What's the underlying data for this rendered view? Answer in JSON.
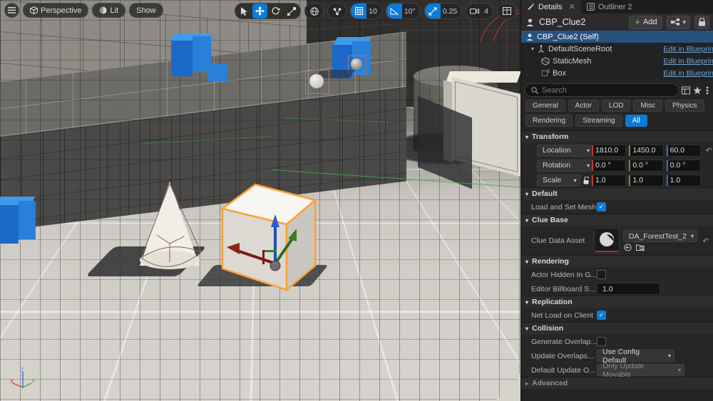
{
  "viewport": {
    "left_toolbar": [
      {
        "name": "viewport-menu",
        "icon": "hamburger-icon",
        "label": ""
      },
      {
        "name": "camera-mode",
        "icon": "cube-icon",
        "label": "Perspective"
      },
      {
        "name": "view-mode",
        "icon": "lit-sphere-icon",
        "label": "Lit"
      },
      {
        "name": "show-flags",
        "icon": "",
        "label": "Show"
      }
    ],
    "right_toolbar": {
      "tools": [
        {
          "name": "select-tool",
          "icon": "cursor-arrow-icon",
          "active": false
        },
        {
          "name": "move-tool",
          "icon": "move-arrows-icon",
          "active": true
        },
        {
          "name": "rotate-tool",
          "icon": "rotate-icon",
          "active": false
        },
        {
          "name": "scale-tool",
          "icon": "scale-icon",
          "active": false
        }
      ],
      "coordinate_system": {
        "name": "world-space-toggle",
        "icon": "globe-icon"
      },
      "surface_snap": {
        "name": "surface-snap-toggle",
        "icon": "surface-snap-icon"
      },
      "grid_snap": {
        "name": "grid-snap",
        "icon": "grid-icon",
        "value": "10",
        "active": true
      },
      "angle_snap": {
        "name": "angle-snap",
        "icon": "angle-icon",
        "value": "10°",
        "active": true
      },
      "scale_snap": {
        "name": "scale-snap",
        "icon": "scale-snap-icon",
        "value": "0.25",
        "active": true
      },
      "camera_speed": {
        "name": "camera-speed",
        "icon": "camera-icon",
        "value": "4"
      },
      "layouts": {
        "name": "viewport-layout",
        "icon": "layout-grid-icon"
      }
    },
    "axis_gizmo": {
      "x": "X",
      "y": "Y",
      "z": "Z"
    }
  },
  "tabs": [
    {
      "name": "tab-details",
      "label": "Details",
      "icon": "wrench-pencil-icon",
      "active": true,
      "closeable": true
    },
    {
      "name": "tab-outliner",
      "label": "Outliner 2",
      "icon": "outliner-icon",
      "active": false,
      "closeable": false
    }
  ],
  "header": {
    "actor_icon": "actor-icon",
    "title": "CBP_Clue2",
    "add_label": "Add",
    "add_icon": "plus-icon",
    "blueprint_icon": "blueprint-nodes-icon",
    "lock_icon": "lock-icon"
  },
  "component_tree": [
    {
      "name": "component-cbp-clue2",
      "label": "CBP_Clue2 (Self)",
      "icon": "actor-icon",
      "indent": 0,
      "selected": true,
      "expander": "",
      "link": ""
    },
    {
      "name": "component-default-scene-root",
      "label": "DefaultSceneRoot",
      "icon": "scene-root-icon",
      "indent": 1,
      "selected": false,
      "expander": "▾",
      "link": "Edit in Blueprin"
    },
    {
      "name": "component-static-mesh",
      "label": "StaticMesh",
      "icon": "static-mesh-icon",
      "indent": 2,
      "selected": false,
      "expander": "",
      "link": "Edit in Blueprin"
    },
    {
      "name": "component-box",
      "label": "Box",
      "icon": "collision-box-icon",
      "indent": 2,
      "selected": false,
      "expander": "",
      "link": "Edit in Blueprin"
    }
  ],
  "search": {
    "placeholder": "Search",
    "icon": "search-icon",
    "table_icon": "table-view-icon",
    "favorite_icon": "star-icon",
    "settings_icon": "settings-icon"
  },
  "filters": [
    {
      "name": "filter-general",
      "label": "General",
      "active": false
    },
    {
      "name": "filter-actor",
      "label": "Actor",
      "active": false
    },
    {
      "name": "filter-lod",
      "label": "LOD",
      "active": false
    },
    {
      "name": "filter-misc",
      "label": "Misc",
      "active": false
    },
    {
      "name": "filter-physics",
      "label": "Physics",
      "active": false
    },
    {
      "name": "filter-rendering",
      "label": "Rendering",
      "active": false
    },
    {
      "name": "filter-streaming",
      "label": "Streaming",
      "active": false
    },
    {
      "name": "filter-all",
      "label": "All",
      "active": true
    }
  ],
  "sections": {
    "transform": {
      "title": "Transform",
      "location": {
        "label": "Location",
        "mode": "Location",
        "x": "1810.0",
        "y": "1450.0",
        "z": "60.0"
      },
      "rotation": {
        "label": "Rotation",
        "mode": "Rotation",
        "x": "0.0 °",
        "y": "0.0 °",
        "z": "0.0 °"
      },
      "scale": {
        "label": "Scale",
        "mode": "Scale",
        "x": "1.0",
        "y": "1.0",
        "z": "1.0",
        "lock_icon": "unlocked-icon"
      },
      "reset_icon": "reset-arrow-icon"
    },
    "default": {
      "title": "Default",
      "load_and_set_mesh": {
        "label": "Load and Set Mesh",
        "checked": true
      }
    },
    "clue_base": {
      "title": "Clue Base",
      "clue_data_asset": {
        "label": "Clue Data Asset",
        "value": "DA_ForestTest_2",
        "thumbnail": "pie-chart-asset-icon",
        "browse_icon": "browse-to-asset-icon",
        "use_selected_icon": "use-selected-asset-icon"
      }
    },
    "rendering": {
      "title": "Rendering",
      "actor_hidden_in_game": {
        "label": "Actor Hidden In G...",
        "checked": false
      },
      "editor_billboard_scale": {
        "label": "Editor Billboard S...",
        "value": "1.0"
      }
    },
    "replication": {
      "title": "Replication",
      "net_load_on_client": {
        "label": "Net Load on Client",
        "checked": true
      }
    },
    "collision": {
      "title": "Collision",
      "generate_overlap_events": {
        "label": "Generate Overlap...",
        "checked": false
      },
      "update_overlaps_method": {
        "label": "Update Overlaps...",
        "value": "Use Config Default"
      },
      "default_update_overlaps": {
        "label": "Default Update O...",
        "value": "Only Update Movable",
        "disabled": true
      }
    },
    "advanced": {
      "title": "Advanced",
      "expander": "▸"
    }
  },
  "colors": {
    "accent_blue": "#0c7bd8",
    "selection_orange": "#ffa033",
    "axis_x": "#c0392b",
    "axis_y": "#4f9c31",
    "axis_z": "#2b6fc9",
    "link_blue": "#6fa8dc"
  }
}
